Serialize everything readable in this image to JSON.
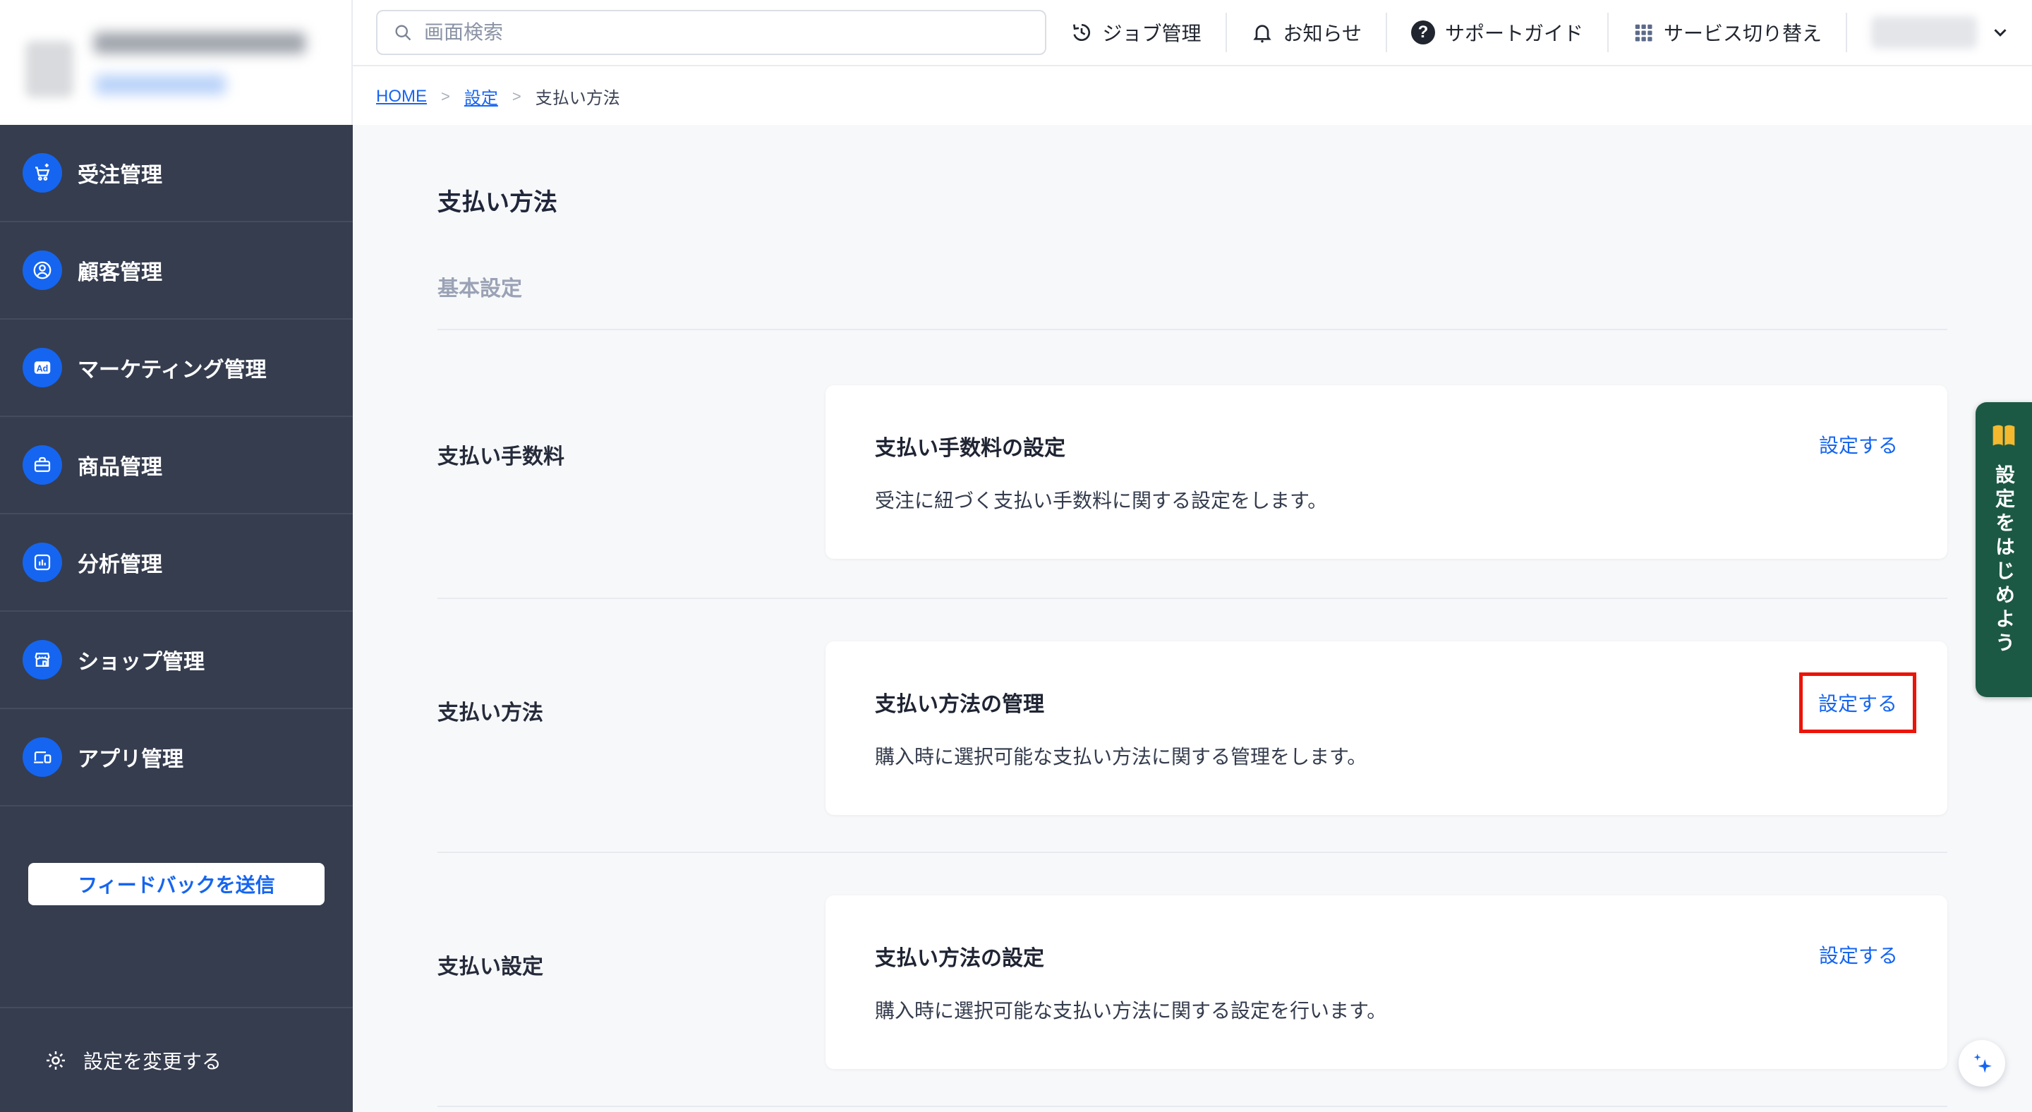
{
  "header": {
    "search_placeholder": "画面検索",
    "nav": {
      "job": "ジョブ管理",
      "news": "お知らせ",
      "support": "サポートガイド",
      "service_switch": "サービス切り替え"
    }
  },
  "breadcrumb": {
    "home": "HOME",
    "settings": "設定",
    "current": "支払い方法",
    "separator": ">"
  },
  "sidebar": {
    "items": [
      {
        "label": "受注管理",
        "icon": "cart-plus-icon"
      },
      {
        "label": "顧客管理",
        "icon": "person-circle-icon"
      },
      {
        "label": "マーケティング管理",
        "icon": "ad-badge-icon"
      },
      {
        "label": "商品管理",
        "icon": "briefcase-icon"
      },
      {
        "label": "分析管理",
        "icon": "bar-chart-icon"
      },
      {
        "label": "ショップ管理",
        "icon": "storefront-icon"
      },
      {
        "label": "アプリ管理",
        "icon": "devices-icon"
      }
    ],
    "feedback_button": "フィードバックを送信",
    "change_settings": "設定を変更する"
  },
  "page": {
    "title": "支払い方法",
    "section": "基本設定",
    "rows": [
      {
        "label": "支払い手数料",
        "card_title": "支払い手数料の設定",
        "description": "受注に紐づく支払い手数料に関する設定をします。",
        "action": "設定する",
        "highlighted": false
      },
      {
        "label": "支払い方法",
        "card_title": "支払い方法の管理",
        "description": "購入時に選択可能な支払い方法に関する管理をします。",
        "action": "設定する",
        "highlighted": true
      },
      {
        "label": "支払い設定",
        "card_title": "支払い方法の設定",
        "description": "購入時に選択可能な支払い方法に関する設定を行います。",
        "action": "設定する",
        "highlighted": false
      }
    ]
  },
  "side_banner": {
    "label": "設定をはじめよう"
  },
  "colors": {
    "accent_blue": "#1565F0",
    "link_blue": "#1765F2",
    "sidebar_bg": "#363D4F",
    "banner_green": "#1C5944",
    "banner_yellow": "#F4B92E",
    "highlight_red": "#EB1409",
    "content_bg": "#F7F8FA"
  }
}
